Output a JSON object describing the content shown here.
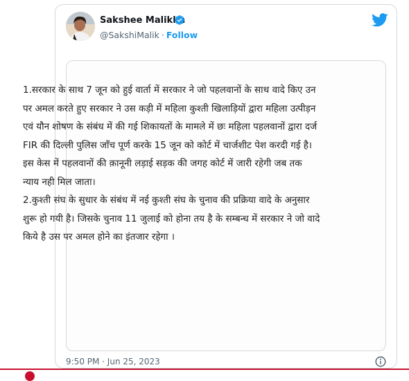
{
  "tweet": {
    "display_name": "Sakshee Malikkh",
    "handle": "@SakshiMalik",
    "separator": "·",
    "follow_label": "Follow",
    "timestamp": "9:50 PM · Jun 25, 2023",
    "icons": {
      "verified": "verified-badge-icon",
      "brand": "twitter-bird-icon",
      "info": "info-icon"
    },
    "colors": {
      "accent": "#1d9bf0",
      "text": "#0f1419",
      "muted": "#536471",
      "alert_red": "#c8102e"
    }
  },
  "image_text": {
    "paragraph_1": "1.सरकार के साथ 7 जून को हुई वार्ता में सरकार ने जो पहलवानों के साथ वादे किए उन पर अमल करते हुए सरकार ने उस कड़ी में महिला कुश्ती खिलाड़ियों द्वारा महिला उत्पीड़न एवं यौन शोषण के संबंध में की गई शिकायतों के मामले में छः महिला पहलवानों द्वारा दर्ज FIR की दिल्ली पुलिस जाँच पूर्ण करके 15 जून को कोर्ट में चार्जशीट पेश करदी गई है। इस केस में पहलवानों की क़ानूनी लड़ाई सड़क की जगह कोर्ट में जारी रहेगी जब तक न्याय नही मिल जाता।",
    "paragraph_2": "2.कुश्ती संघ के सुधार के संबंध में नई कुश्ती संघ के चुनाव की प्रक्रिया वादे के अनुसार शुरू हो गयी है। जिसके चुनाव 11 जुलाई को होना तय है के सम्बन्ध में सरकार ने जो वादे किये है उस पर अमल होने का इंतजार रहेगा ।"
  }
}
